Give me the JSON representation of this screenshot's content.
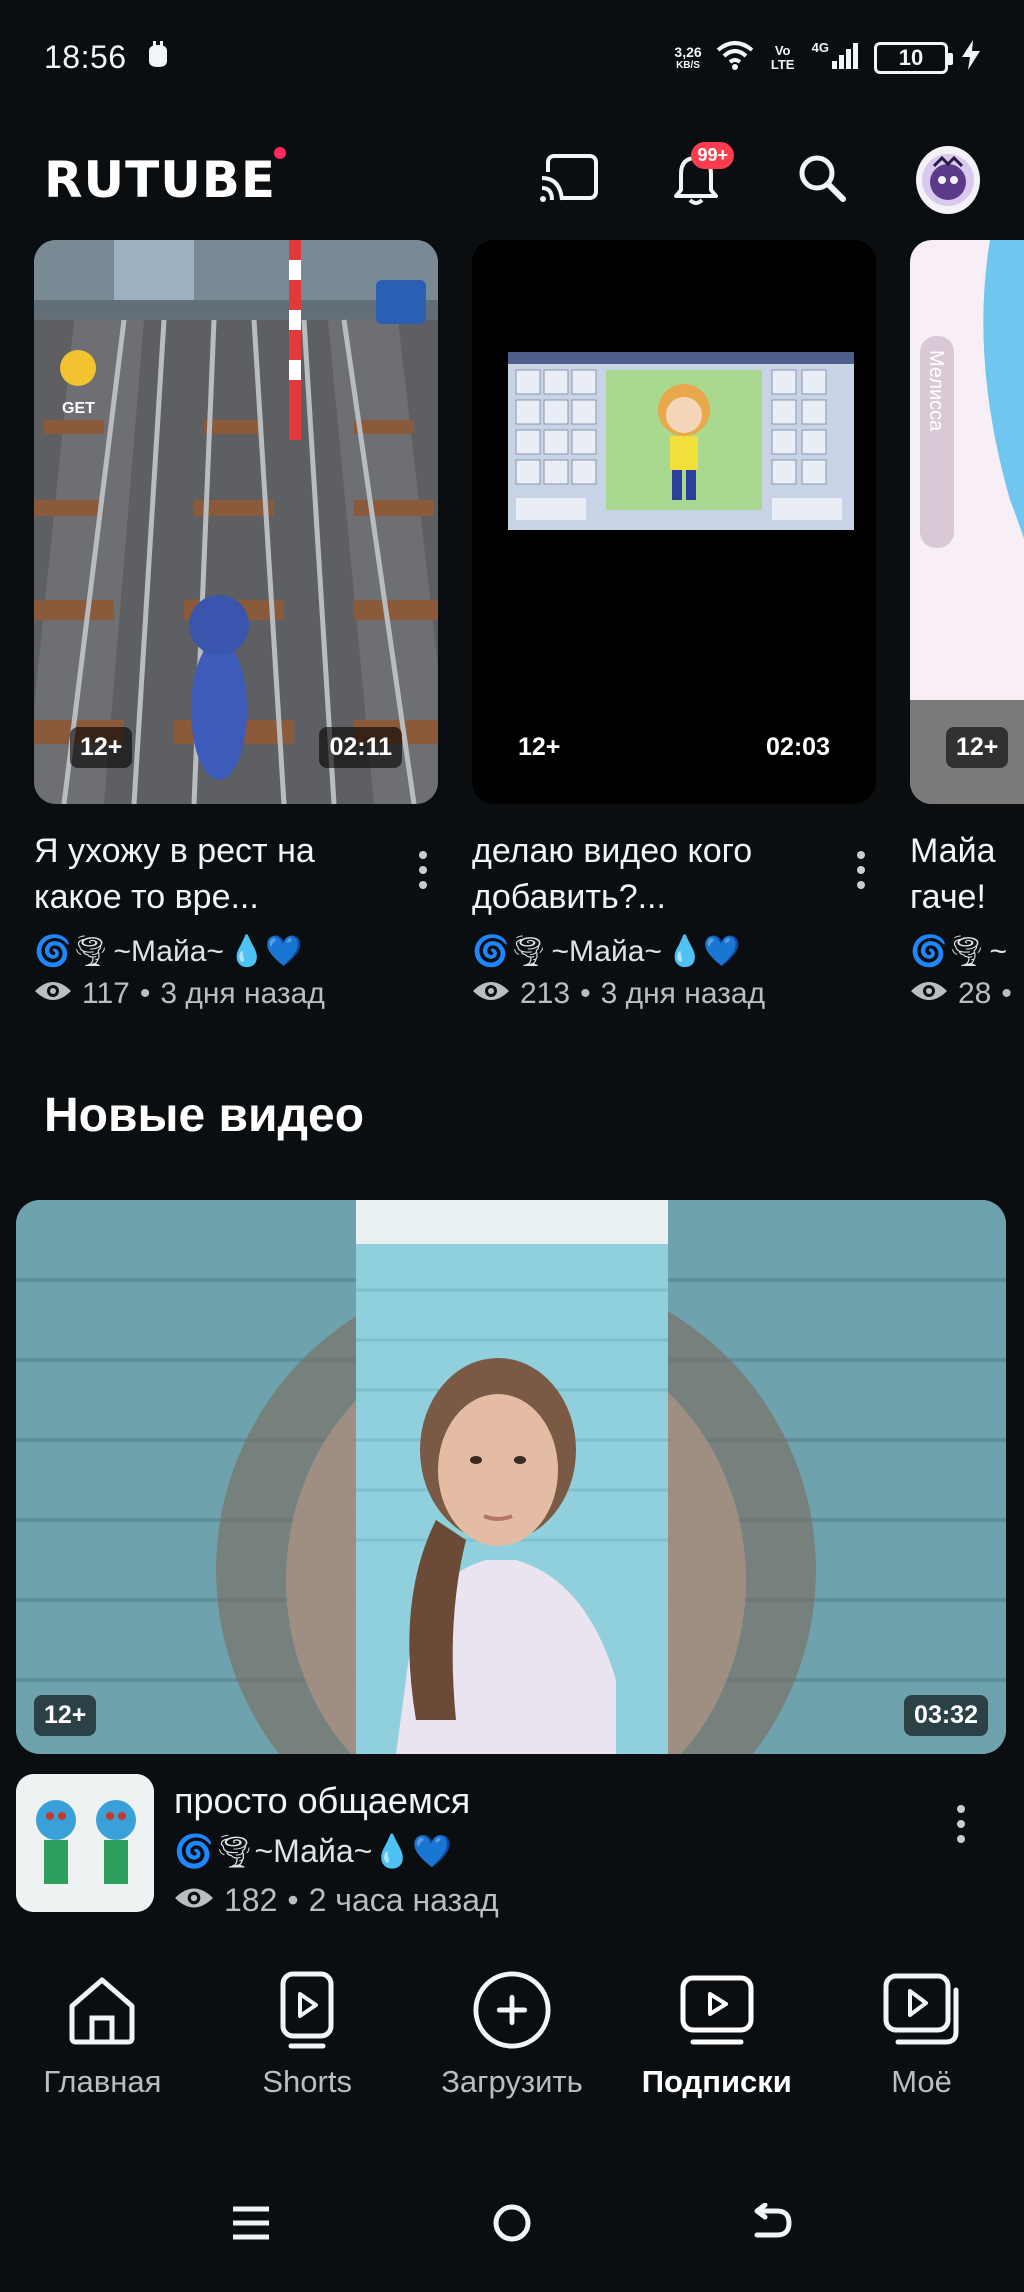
{
  "status_bar": {
    "time": "18:56",
    "net_speed_value": "3,26",
    "net_speed_unit": "KB/S",
    "volte": "Vo LTE",
    "network": "4G",
    "battery": "10"
  },
  "header": {
    "logo": "RUTUBE",
    "notifications_badge": "99+"
  },
  "shorts": [
    {
      "title": "Я ухожу в рест на какое то вре...",
      "author_prefix": "🌀🌪",
      "author": "~Майа~",
      "author_suffix": "💧💙",
      "views": "117",
      "age": "3 дня назад",
      "rating": "12+",
      "duration": "02:11",
      "thumb_text": "GET"
    },
    {
      "title": "делаю видео кого добавить?...",
      "author_prefix": "🌀🌪",
      "author": "~Майа~",
      "author_suffix": "💧💙",
      "views": "213",
      "age": "3 дня назад",
      "rating": "12+",
      "duration": "02:03"
    },
    {
      "title": "Майа гаче!",
      "author_prefix": "🌀🌪",
      "author": "~",
      "author_suffix": "",
      "views": "28",
      "age": "",
      "rating": "12+",
      "duration": "",
      "thumb_text": "Мелисса"
    }
  ],
  "new_videos": {
    "section_title": "Новые видео",
    "items": [
      {
        "title": "просто общаемся",
        "author_prefix": "🌀🌪",
        "author": "~Майа~",
        "author_suffix": "💧💙",
        "views": "182",
        "age": "2 часа назад",
        "rating": "12+",
        "duration": "03:32"
      }
    ]
  },
  "bottom_nav": [
    {
      "label": "Главная",
      "icon": "home-icon",
      "active": false
    },
    {
      "label": "Shorts",
      "icon": "shorts-icon",
      "active": false
    },
    {
      "label": "Загрузить",
      "icon": "upload-plus-icon",
      "active": false
    },
    {
      "label": "Подписки",
      "icon": "subscriptions-icon",
      "active": true
    },
    {
      "label": "Моё",
      "icon": "library-icon",
      "active": false
    }
  ],
  "colors": {
    "background": "#0b0e10",
    "text": "#f2f4f5",
    "muted": "#b8bec3",
    "badge": "#ff3b4e",
    "logo_dot": "#ff2a5a"
  }
}
